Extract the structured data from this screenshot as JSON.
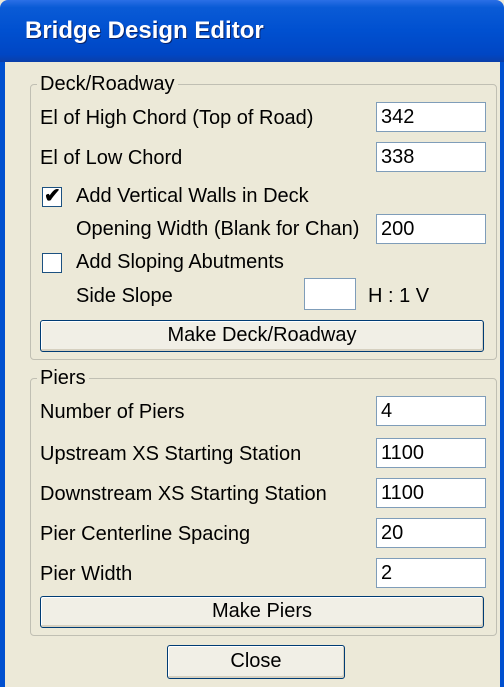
{
  "window": {
    "title": "Bridge Design Editor"
  },
  "deck": {
    "legend": "Deck/Roadway",
    "high_chord_label": "El of High Chord (Top of Road)",
    "high_chord_value": "342",
    "low_chord_label": "El of Low Chord",
    "low_chord_value": "338",
    "vertical_walls_label": "Add Vertical Walls in Deck",
    "vertical_walls_checked": true,
    "opening_width_label": "Opening Width (Blank for Chan)",
    "opening_width_value": "200",
    "sloping_abutments_label": "Add Sloping Abutments",
    "sloping_abutments_checked": false,
    "side_slope_label": "Side Slope",
    "side_slope_value": "",
    "side_slope_unit": "H : 1 V",
    "make_button": "Make Deck/Roadway"
  },
  "piers": {
    "legend": "Piers",
    "number_label": "Number of Piers",
    "number_value": "4",
    "upstream_label": "Upstream XS Starting Station",
    "upstream_value": "1100",
    "downstream_label": "Downstream XS Starting Station",
    "downstream_value": "1100",
    "spacing_label": "Pier Centerline Spacing",
    "spacing_value": "20",
    "width_label": "Pier Width",
    "width_value": "2",
    "make_button": "Make Piers"
  },
  "close_button": "Close",
  "checkmark_glyph": "✔"
}
